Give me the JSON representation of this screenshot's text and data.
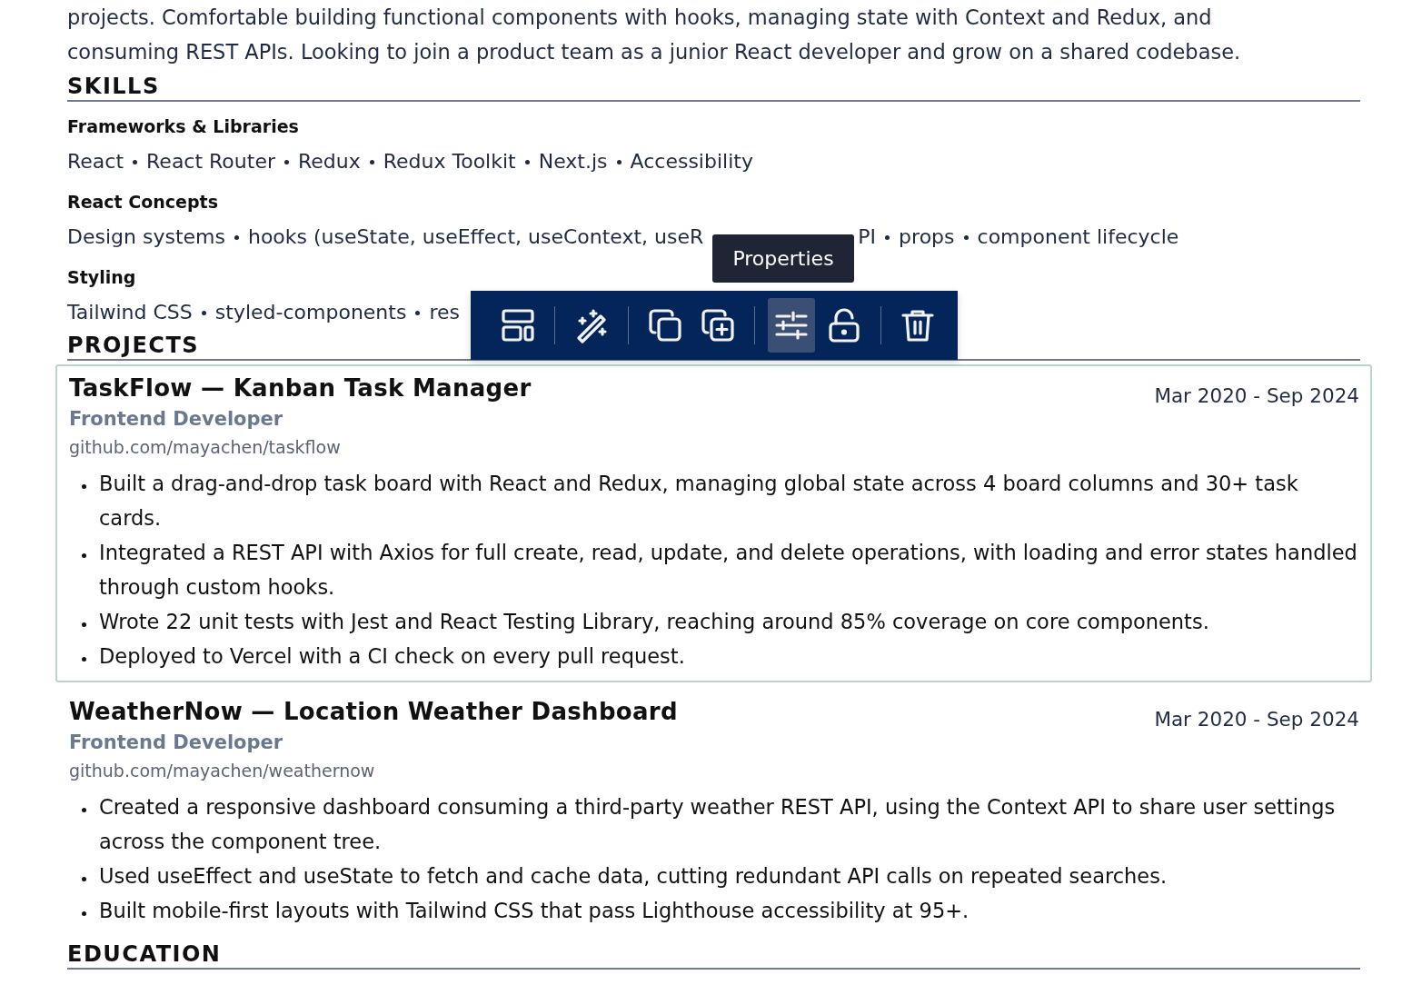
{
  "summary": [
    "projects. Comfortable building functional components with hooks, managing state with Context and Redux, and",
    "consuming REST APIs. Looking to join a product team as a junior React developer and grow on a shared codebase."
  ],
  "sections": [
    {
      "kind": "skills",
      "title": "SKILLS",
      "groups": [
        {
          "name": "Frameworks & Libraries",
          "items": [
            {
              "kind": "item",
              "text": "React"
            },
            {
              "kind": "item",
              "text": "React Router"
            },
            {
              "kind": "item",
              "text": "Redux"
            },
            {
              "kind": "item",
              "text": "Redux Toolkit"
            },
            {
              "kind": "item",
              "text": "Next.js"
            },
            {
              "kind": "item",
              "text": "Accessibility"
            }
          ]
        },
        {
          "name": "React Concepts",
          "items": [
            {
              "kind": "item",
              "text": "Design systems"
            },
            {
              "kind": "item",
              "text": "hooks (useState, useEffect, useContext, useR"
            },
            {
              "kind": "after_cover",
              "text": "PI"
            },
            {
              "kind": "item",
              "text": "props"
            },
            {
              "kind": "item",
              "text": "component lifecycle"
            }
          ]
        },
        {
          "name": "Styling",
          "items": [
            {
              "kind": "item",
              "text": "Tailwind CSS"
            },
            {
              "kind": "item",
              "text": "styled-components"
            },
            {
              "kind": "item",
              "text": "res"
            }
          ]
        }
      ]
    },
    {
      "kind": "projects",
      "title": "PROJECTS",
      "projects": [
        {
          "title": "TaskFlow — Kanban Task Manager",
          "role": "Frontend Developer",
          "link": "github.com/mayachen/taskflow",
          "dates": "Mar 2020 - Sep 2024",
          "selected": true,
          "bullets": [
            "Built a drag-and-drop task board with React and Redux, managing global state across 4 board columns and 30+ task cards.",
            "Integrated a REST API with Axios for full create, read, update, and delete operations, with loading and error states handled through custom hooks.",
            "Wrote 22 unit tests with Jest and React Testing Library, reaching around 85% coverage on core components.",
            "Deployed to Vercel with a CI check on every pull request."
          ]
        },
        {
          "title": "WeatherNow — Location Weather Dashboard",
          "role": "Frontend Developer",
          "link": "github.com/mayachen/weathernow",
          "dates": "Mar 2020 - Sep 2024",
          "selected": false,
          "bullets": [
            "Created a responsive dashboard consuming a third-party weather REST API, using the Context API to share user settings across the component tree.",
            "Used useEffect and useState to fetch and cache data, cutting redundant API calls on repeated searches.",
            "Built mobile-first layouts with Tailwind CSS that pass Lighthouse accessibility at 95+."
          ]
        }
      ]
    },
    {
      "kind": "heading",
      "title": "EDUCATION"
    }
  ],
  "toolbar": {
    "tooltip": "Properties",
    "groups": [
      [
        {
          "kind": "layout",
          "selected": false
        }
      ],
      [
        {
          "kind": "wand",
          "selected": false
        }
      ],
      [
        {
          "kind": "copy",
          "selected": false
        },
        {
          "kind": "duplicate",
          "selected": false
        }
      ],
      [
        {
          "kind": "sliders",
          "selected": true
        },
        {
          "kind": "unlock",
          "selected": false
        }
      ],
      [
        {
          "kind": "trash",
          "selected": false
        }
      ]
    ]
  }
}
